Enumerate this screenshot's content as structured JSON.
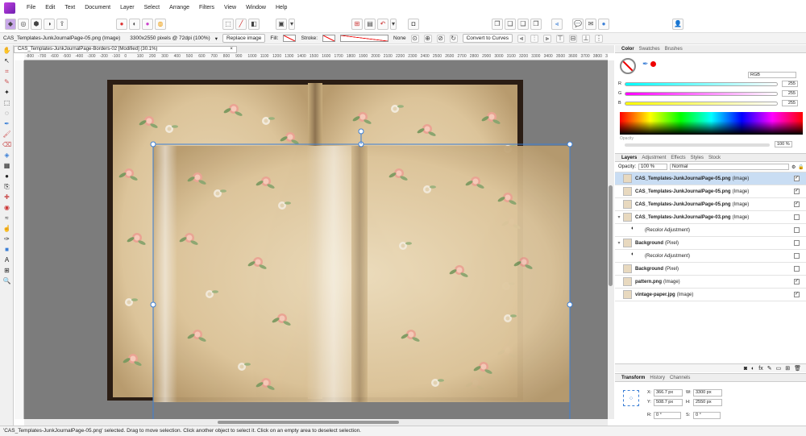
{
  "menu": {
    "items": [
      "File",
      "Edit",
      "Text",
      "Document",
      "Layer",
      "Select",
      "Arrange",
      "Filters",
      "View",
      "Window",
      "Help"
    ]
  },
  "context_bar": {
    "layer_info": "CAS_Templates-JunkJournalPage-05.png (Image)",
    "dimensions": "3300x2550 pixels @ 72dpi (100%)",
    "replace_image": "Replace image",
    "fill_label": "Fill:",
    "stroke_label": "Stroke:",
    "stroke_none": "None",
    "convert_to_curves": "Convert to Curves"
  },
  "document": {
    "tab_title": "CAS_Templates-JunkJournalPage-Borders-02 [Modified] (30.1%)",
    "tab_close": "×"
  },
  "ruler": {
    "ticks": [
      "-800",
      "-700",
      "-600",
      "-500",
      "-400",
      "-300",
      "-200",
      "-100",
      "0",
      "100",
      "200",
      "300",
      "400",
      "500",
      "600",
      "700",
      "800",
      "900",
      "1000",
      "1100",
      "1200",
      "1300",
      "1400",
      "1500",
      "1600",
      "1700",
      "1800",
      "1900",
      "2000",
      "2100",
      "2200",
      "2300",
      "2400",
      "2500",
      "2600",
      "2700",
      "2800",
      "2900",
      "3000",
      "3100",
      "3200",
      "3300",
      "3400",
      "3500",
      "3600",
      "3700",
      "3800",
      "3900",
      "4000"
    ]
  },
  "color_panel": {
    "tabs": [
      "Color",
      "Swatches",
      "Brushes"
    ],
    "model": "RGB",
    "channels": [
      {
        "label": "R",
        "value": "255"
      },
      {
        "label": "G",
        "value": "255"
      },
      {
        "label": "B",
        "value": "255"
      }
    ],
    "opacity_label": "Opacity",
    "opacity_value": "100 %"
  },
  "layers_panel": {
    "tabs": [
      "Layers",
      "Adjustment",
      "Effects",
      "Styles",
      "Stock"
    ],
    "opacity_label": "Opacity:",
    "opacity_value": "100 %",
    "blend_mode": "Normal",
    "layers": [
      {
        "name": "CAS_Templates-JunkJournalPage-05.png",
        "kind": "(Image)",
        "selected": true,
        "checked": true,
        "child": false,
        "expand": ""
      },
      {
        "name": "CAS_Templates-JunkJournalPage-05.png",
        "kind": "(Image)",
        "selected": false,
        "checked": true,
        "child": false,
        "expand": ""
      },
      {
        "name": "CAS_Templates-JunkJournalPage-05.png",
        "kind": "(Image)",
        "selected": false,
        "checked": true,
        "child": false,
        "expand": ""
      },
      {
        "name": "CAS_Templates-JunkJournalPage-03.png",
        "kind": "(Image)",
        "selected": false,
        "checked": false,
        "child": false,
        "expand": "▾"
      },
      {
        "name": "",
        "kind": "(Recolor Adjustment)",
        "selected": false,
        "checked": false,
        "child": true,
        "expand": ""
      },
      {
        "name": "Background",
        "kind": "(Pixel)",
        "selected": false,
        "checked": false,
        "child": false,
        "expand": "▾"
      },
      {
        "name": "",
        "kind": "(Recolor Adjustment)",
        "selected": false,
        "checked": false,
        "child": true,
        "expand": ""
      },
      {
        "name": "Background",
        "kind": "(Pixel)",
        "selected": false,
        "checked": false,
        "child": false,
        "expand": ""
      },
      {
        "name": "pattern.png",
        "kind": "(Image)",
        "selected": false,
        "checked": true,
        "child": false,
        "expand": ""
      },
      {
        "name": "vintage-paper.jpg",
        "kind": "(Image)",
        "selected": false,
        "checked": true,
        "child": false,
        "expand": ""
      }
    ]
  },
  "transform_panel": {
    "tabs": [
      "Transform",
      "History",
      "Channels"
    ],
    "x_label": "X:",
    "x_value": "366.7 px",
    "y_label": "Y:",
    "y_value": "508.7 px",
    "w_label": "W:",
    "w_value": "3300 px",
    "h_label": "H:",
    "h_value": "2550 px",
    "r_label": "R:",
    "r_value": "0 °",
    "s_label": "S:",
    "s_value": "0 °"
  },
  "status": {
    "text": "'CAS_Templates-JunkJournalPage-05.png' selected. Drag to move selection. Click another object to select it. Click on an empty area to deselect selection."
  },
  "colors": {
    "accent": "#3b7fd6",
    "canvas_bg": "#7c7c7c",
    "paper": "#e6d3b0",
    "border_dark": "#2b1d14",
    "rose": "#e9a698",
    "leaf": "#8aa56f"
  }
}
